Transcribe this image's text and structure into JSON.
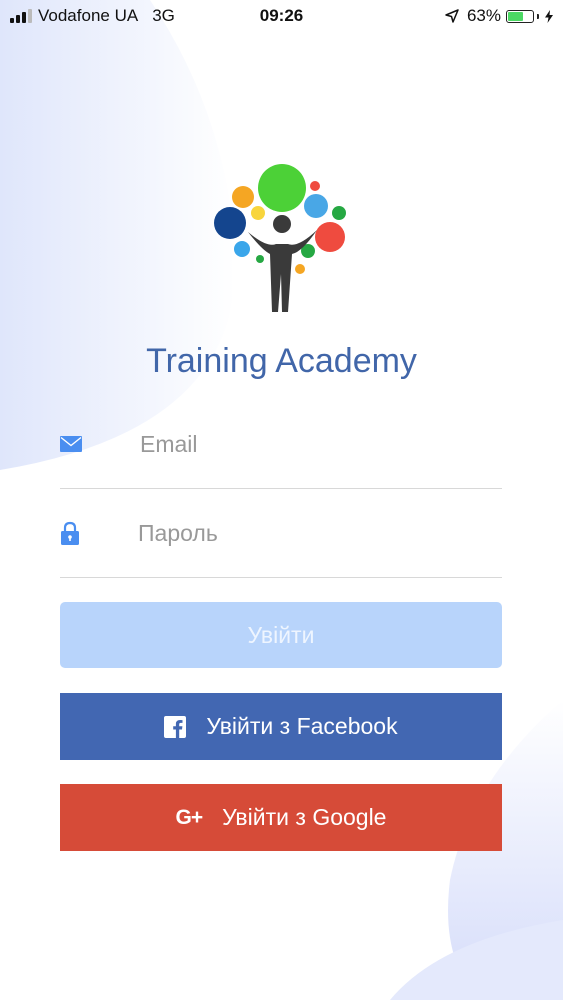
{
  "status_bar": {
    "carrier": "Vodafone UA",
    "network": "3G",
    "time": "09:26",
    "battery_percent": "63%",
    "battery_level": 0.63
  },
  "app": {
    "title": "Training Academy"
  },
  "login_form": {
    "email_placeholder": "Email",
    "password_placeholder": "Пароль",
    "login_label": "Увійти",
    "facebook_label": "Увійти з Facebook",
    "google_label": "Увійти з Google",
    "google_icon_text": "G+"
  },
  "colors": {
    "title": "#4166a9",
    "login_button": "#b8d4fb",
    "facebook_button": "#4267b2",
    "google_button": "#d64b38",
    "field_icon": "#4a8ef0"
  },
  "icons": {
    "email": "mail-icon",
    "password": "lock-icon",
    "facebook": "facebook-icon",
    "google": "google-plus-icon",
    "location": "location-arrow-icon",
    "charging": "lightning-bolt-icon"
  }
}
